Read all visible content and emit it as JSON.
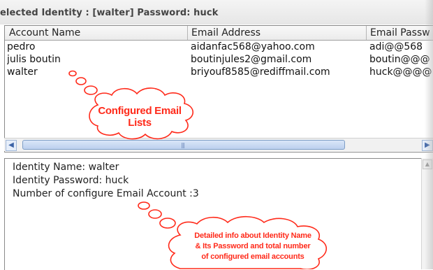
{
  "title": "elected Identity : [walter]  Password: huck",
  "columns": [
    {
      "label": "Account Name"
    },
    {
      "label": "Email Address"
    },
    {
      "label": "Email Passw"
    }
  ],
  "rows": [
    {
      "account": "pedro",
      "email": "aidanfac568@yahoo.com",
      "password": "adi@@568"
    },
    {
      "account": "julis boutin",
      "email": "boutinjules2@gmail.com",
      "password": "boutin@@@"
    },
    {
      "account": "walter",
      "email": "briyouf8585@rediffmail.com",
      "password": "huck@@@@"
    }
  ],
  "details": {
    "identity_name": "Identity Name: walter",
    "identity_password": "Identity Password: huck",
    "account_count": "Number of configure Email Account :3"
  },
  "annotations": {
    "lists_line1": "Configured Email",
    "lists_line2": "Lists",
    "info_line1": "Detailed info about Identity Name",
    "info_line2": "& Its Password and total number",
    "info_line3": "of configured email accounts"
  },
  "colors": {
    "annotation": "#ff2a1a",
    "scroll_thumb": "#bcd0ee"
  }
}
